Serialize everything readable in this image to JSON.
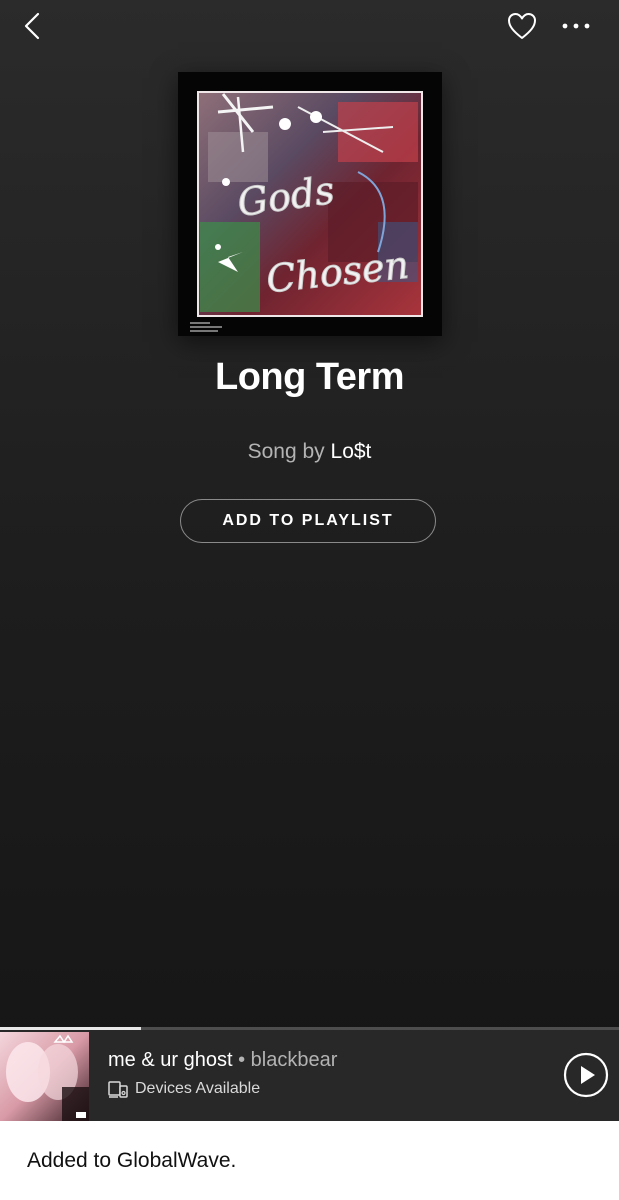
{
  "header": {
    "back_icon": "chevron-left-icon",
    "like_icon": "heart-outline-icon",
    "more_icon": "more-horizontal-icon"
  },
  "album": {
    "cover_text": [
      "Gods",
      "Chosen"
    ]
  },
  "track": {
    "title": "Long Term",
    "subtitle_prefix": "Song by",
    "artist": "Lo$t",
    "add_button_label": "ADD TO PLAYLIST"
  },
  "now_playing": {
    "song": "me & ur ghost",
    "separator": "•",
    "artist": "blackbear",
    "devices_label": "Devices Available",
    "devices_icon": "devices-icon",
    "play_icon": "play-circle-icon",
    "progress": 0.227
  },
  "toast": {
    "message": "Added to GlobalWave."
  },
  "colors": {
    "background_top": "#2b2b2b",
    "background_bottom": "#141414",
    "mini_player": "#282828",
    "secondary_text": "#b3b3b3",
    "toast_bg": "#ffffff"
  }
}
